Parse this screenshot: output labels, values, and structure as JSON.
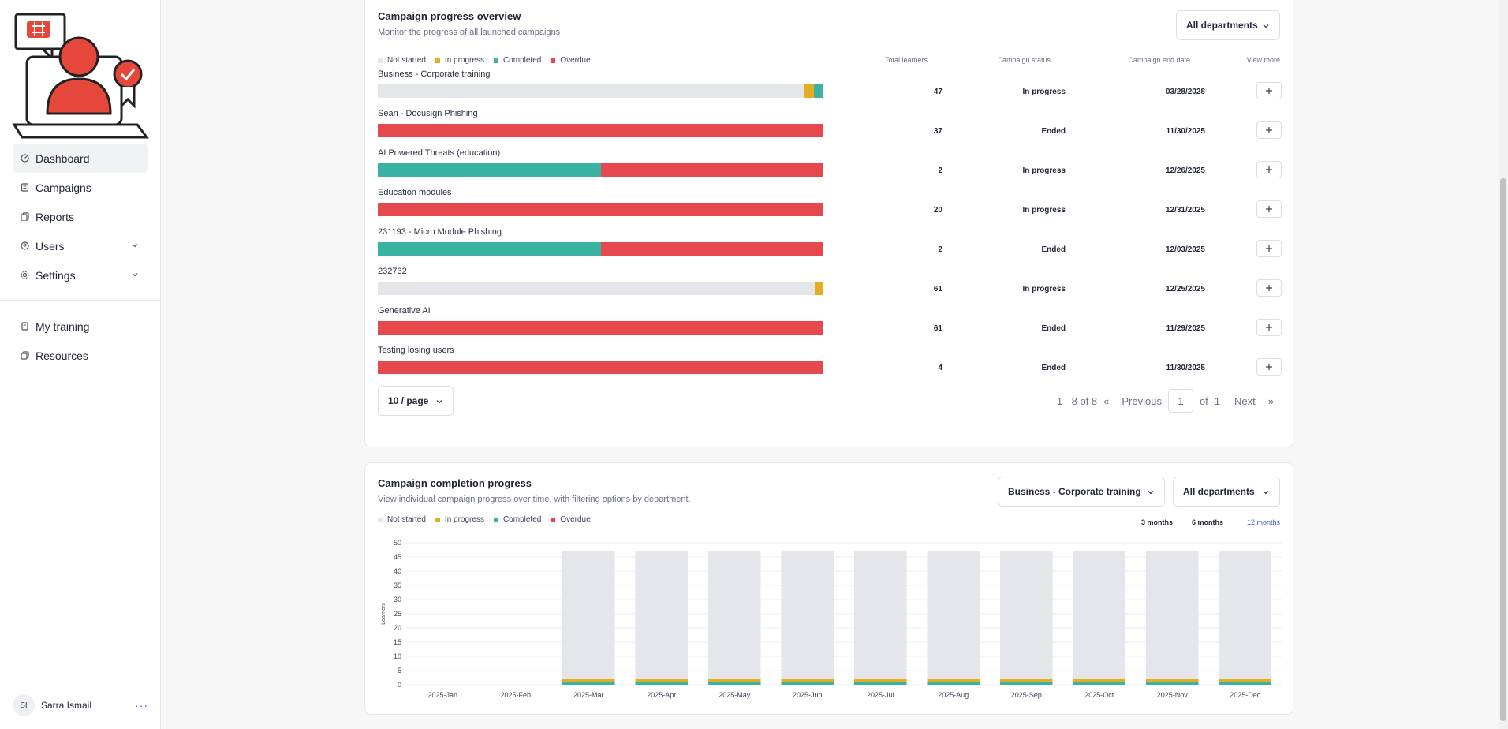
{
  "sidebar": {
    "nav": [
      {
        "label": "Dashboard",
        "icon": "dashboard-icon",
        "active": true
      },
      {
        "label": "Campaigns",
        "icon": "campaigns-icon"
      },
      {
        "label": "Reports",
        "icon": "reports-icon"
      },
      {
        "label": "Users",
        "icon": "users-icon",
        "expandable": true
      },
      {
        "label": "Settings",
        "icon": "settings-icon",
        "expandable": true
      }
    ],
    "nav2": [
      {
        "label": "My training",
        "icon": "training-icon"
      },
      {
        "label": "Resources",
        "icon": "resources-icon"
      }
    ],
    "user": {
      "initials": "SI",
      "name": "Sarra Ismail",
      "menu": "···"
    }
  },
  "overview": {
    "title": "Campaign progress overview",
    "subtitle": "Monitor the progress of all launched campaigns",
    "department_select": "All departments",
    "legend": [
      "Not started",
      "In progress",
      "Completed",
      "Overdue"
    ],
    "columns": {
      "learners": "Total learners",
      "status": "Campaign status",
      "end": "Campaign end date",
      "more": "View more"
    },
    "rows": [
      {
        "name": "Business - Corporate training",
        "not_started": 0.958,
        "in_progress": 0.021,
        "completed": 0.021,
        "overdue": 0,
        "learners": "47",
        "status": "In progress",
        "end": "03/28/2028"
      },
      {
        "name": "Sean - Docusign Phishing",
        "not_started": 0,
        "in_progress": 0,
        "completed": 0,
        "overdue": 1,
        "learners": "37",
        "status": "Ended",
        "end": "11/30/2025"
      },
      {
        "name": "AI Powered Threats (education)",
        "not_started": 0,
        "in_progress": 0,
        "completed": 0.5,
        "overdue": 0.5,
        "learners": "2",
        "status": "In progress",
        "end": "12/26/2025"
      },
      {
        "name": "Education modules",
        "not_started": 0,
        "in_progress": 0,
        "completed": 0,
        "overdue": 1,
        "learners": "20",
        "status": "In progress",
        "end": "12/31/2025"
      },
      {
        "name": "231193 - Micro Module Phishing",
        "not_started": 0,
        "in_progress": 0,
        "completed": 0.5,
        "overdue": 0.5,
        "learners": "2",
        "status": "Ended",
        "end": "12/03/2025"
      },
      {
        "name": "232732",
        "not_started": 0.98,
        "in_progress": 0.02,
        "completed": 0,
        "overdue": 0,
        "learners": "61",
        "status": "In progress",
        "end": "12/25/2025"
      },
      {
        "name": "Generative AI",
        "not_started": 0,
        "in_progress": 0,
        "completed": 0,
        "overdue": 1,
        "learners": "61",
        "status": "Ended",
        "end": "11/29/2025"
      },
      {
        "name": "Testing losing users",
        "not_started": 0,
        "in_progress": 0,
        "completed": 0,
        "overdue": 1,
        "learners": "4",
        "status": "Ended",
        "end": "11/30/2025"
      }
    ],
    "pager": {
      "page_size": "10 / page",
      "range": "1 - 8 of 8",
      "first": "«",
      "previous": "Previous",
      "page": "1",
      "of": "of",
      "total": "1",
      "next": "Next",
      "last": "»"
    }
  },
  "completion": {
    "title": "Campaign completion progress",
    "subtitle": "View individual campaign progress over time, with filtering options by department.",
    "campaign_select": "Business - Corporate training",
    "department_select": "All departments",
    "legend": [
      "Not started",
      "In progress",
      "Completed",
      "Overdue"
    ],
    "ranges": [
      "3 months",
      "6 months",
      "12 months"
    ]
  },
  "colors": {
    "not_started": "#e5e6e9",
    "in_progress": "#e3ad24",
    "completed": "#3bb3a2",
    "overdue": "#e5484d",
    "accent": "#3c5ad6"
  },
  "chart_data": {
    "type": "bar",
    "stacked": true,
    "categories": [
      "2025-Jan",
      "2025-Feb",
      "2025-Mar",
      "2025-Apr",
      "2025-May",
      "2025-Jun",
      "2025-Jul",
      "2025-Aug",
      "2025-Sep",
      "2025-Oct",
      "2025-Nov",
      "2025-Dec"
    ],
    "series": [
      {
        "name": "Completed",
        "values": [
          0,
          0,
          1,
          1,
          1,
          1,
          1,
          1,
          1,
          1,
          1,
          1
        ]
      },
      {
        "name": "In progress",
        "values": [
          0,
          0,
          1,
          1,
          1,
          1,
          1,
          1,
          1,
          1,
          1,
          1
        ]
      },
      {
        "name": "Not started",
        "values": [
          0,
          0,
          45,
          45,
          45,
          45,
          45,
          45,
          45,
          45,
          45,
          45
        ]
      },
      {
        "name": "Overdue",
        "values": [
          0,
          0,
          0,
          0,
          0,
          0,
          0,
          0,
          0,
          0,
          0,
          0
        ]
      }
    ],
    "ylabel": "Learners",
    "xlabel": "",
    "ylim": [
      0,
      50
    ],
    "yticks": [
      0,
      5,
      10,
      15,
      20,
      25,
      30,
      35,
      40,
      45,
      50
    ],
    "grid": true
  }
}
